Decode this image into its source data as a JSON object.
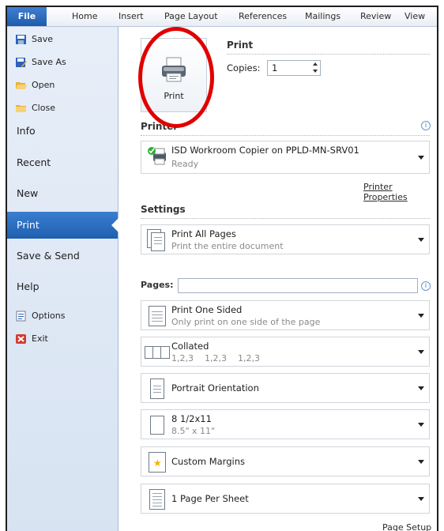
{
  "ribbon": {
    "tabs": [
      "File",
      "Home",
      "Insert",
      "Page Layout",
      "References",
      "Mailings",
      "Review",
      "View"
    ]
  },
  "sidebar": {
    "small_top": [
      "Save",
      "Save As",
      "Open",
      "Close"
    ],
    "big": [
      "Info",
      "Recent",
      "New",
      "Print",
      "Save & Send",
      "Help"
    ],
    "small_bottom": [
      "Options",
      "Exit"
    ],
    "active": "Print"
  },
  "print": {
    "heading": "Print",
    "button_label": "Print",
    "copies_label": "Copies:",
    "copies_value": "1"
  },
  "printer": {
    "heading": "Printer",
    "name": "ISD Workroom Copier on PPLD-MN-SRV01",
    "status": "Ready",
    "properties_link": "Printer Properties"
  },
  "settings": {
    "heading": "Settings",
    "pages_label": "Pages:",
    "pages_value": "",
    "items": [
      {
        "t1": "Print All Pages",
        "t2": "Print the entire document"
      },
      {
        "t1": "Print One Sided",
        "t2": "Only print on one side of the page"
      },
      {
        "t1": "Collated",
        "t2": "1,2,3    1,2,3    1,2,3"
      },
      {
        "t1": "Portrait Orientation",
        "t2": ""
      },
      {
        "t1": "8 1/2x11",
        "t2": "8.5\" x 11\""
      },
      {
        "t1": "Custom Margins",
        "t2": ""
      },
      {
        "t1": "1 Page Per Sheet",
        "t2": ""
      }
    ],
    "page_setup_link": "Page Setup"
  },
  "colors": {
    "accent": "#2a6bc1",
    "highlight_circle": "#e00000"
  }
}
